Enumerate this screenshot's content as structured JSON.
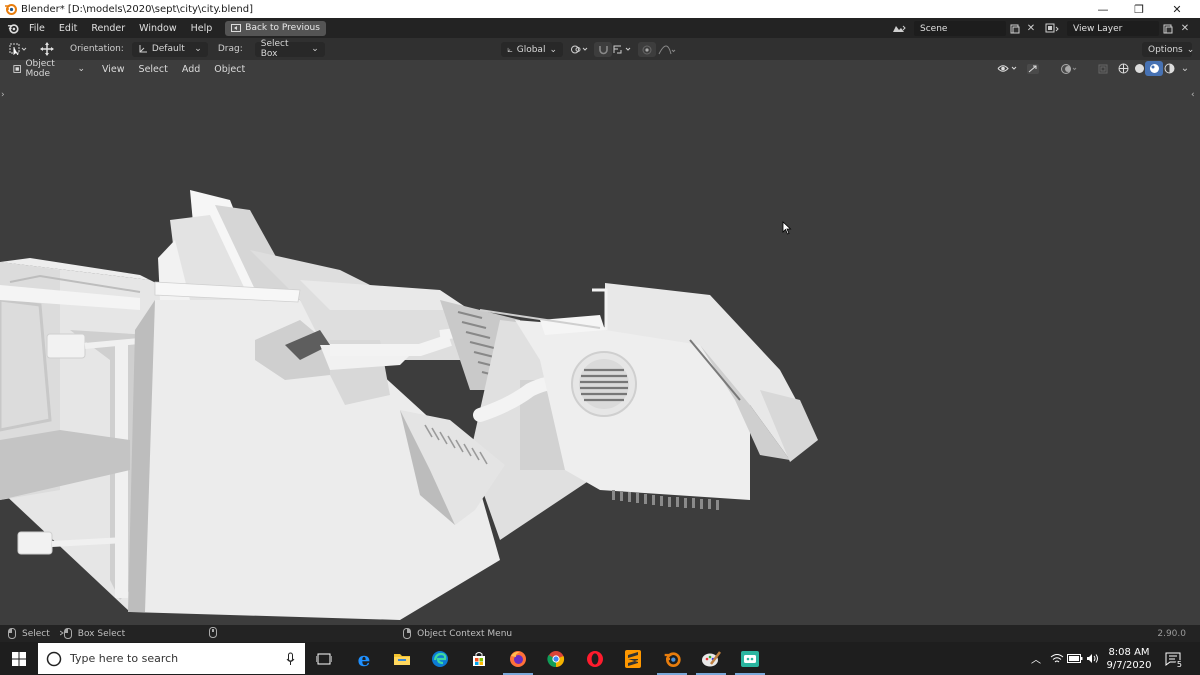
{
  "window": {
    "title": "Blender* [D:\\models\\2020\\sept\\city\\city.blend]",
    "minimize": "—",
    "restore": "❐",
    "close": "✕"
  },
  "menubar": {
    "items": [
      "File",
      "Edit",
      "Render",
      "Window",
      "Help"
    ],
    "back_button": "Back to Previous",
    "scene_field": "Scene",
    "view_layer_field": "View Layer"
  },
  "toolheader": {
    "orientation_label": "Orientation:",
    "orientation_value": "Default",
    "drag_label": "Drag:",
    "drag_value": "Select Box",
    "transform_orientation": "Global",
    "options": "Options"
  },
  "viewport_header": {
    "mode": "Object Mode",
    "items": [
      "View",
      "Select",
      "Add",
      "Object"
    ]
  },
  "statusbar": {
    "select": "Select",
    "box_select": "Box Select",
    "context_menu": "Object Context Menu",
    "version": "2.90.0"
  },
  "taskbar": {
    "search_placeholder": "Type here to search",
    "time": "8:08 AM",
    "date": "9/7/2020",
    "notifications": "5"
  },
  "colors": {
    "blender_orange": "#e87d0d",
    "model_light": "#f2f2f2",
    "model_mid": "#d9d9d9",
    "model_dark": "#a8a8a8",
    "viewport_bg": "#3d3d3d"
  }
}
